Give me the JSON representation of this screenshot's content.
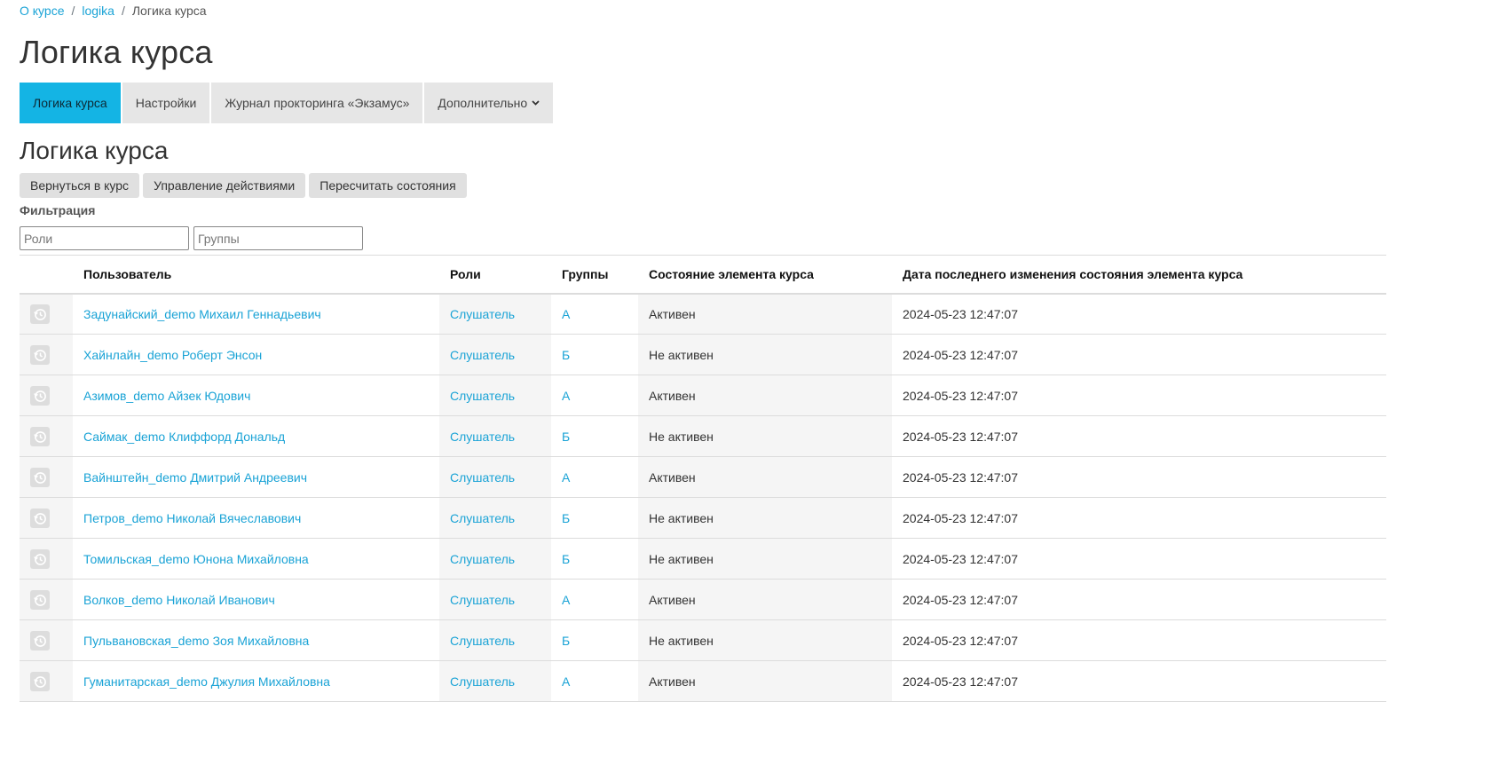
{
  "breadcrumb": {
    "items": [
      {
        "label": "О курсе",
        "link": true
      },
      {
        "label": "logika",
        "link": true
      },
      {
        "label": "Логика курса",
        "link": false
      }
    ],
    "separator": "/"
  },
  "page_title": "Логика курса",
  "tabs": [
    {
      "label": "Логика курса",
      "active": true
    },
    {
      "label": "Настройки",
      "active": false
    },
    {
      "label": "Журнал прокторинга «Экзамус»",
      "active": false
    },
    {
      "label": "Дополнительно",
      "active": false,
      "dropdown": true
    }
  ],
  "section_title": "Логика курса",
  "actions": {
    "back": "Вернуться в курс",
    "manage": "Управление действиями",
    "recalc": "Пересчитать состояния"
  },
  "filter": {
    "label": "Фильтрация",
    "roles_placeholder": "Роли",
    "groups_placeholder": "Группы"
  },
  "table": {
    "headers": {
      "user": "Пользователь",
      "roles": "Роли",
      "groups": "Группы",
      "state": "Состояние элемента курса",
      "date": "Дата последнего изменения состояния элемента курса"
    },
    "rows": [
      {
        "user": "Задунайский_demo Михаил Геннадьевич",
        "role": "Слушатель",
        "group": "А",
        "state": "Активен",
        "date": "2024-05-23 12:47:07"
      },
      {
        "user": "Хайнлайн_demo Роберт Энсон",
        "role": "Слушатель",
        "group": "Б",
        "state": "Не активен",
        "date": "2024-05-23 12:47:07"
      },
      {
        "user": "Азимов_demo Айзек Юдович",
        "role": "Слушатель",
        "group": "А",
        "state": "Активен",
        "date": "2024-05-23 12:47:07"
      },
      {
        "user": "Саймак_demo Клиффорд Дональд",
        "role": "Слушатель",
        "group": "Б",
        "state": "Не активен",
        "date": "2024-05-23 12:47:07"
      },
      {
        "user": "Вайнштейн_demo Дмитрий Андреевич",
        "role": "Слушатель",
        "group": "А",
        "state": "Активен",
        "date": "2024-05-23 12:47:07"
      },
      {
        "user": "Петров_demo Николай Вячеславович",
        "role": "Слушатель",
        "group": "Б",
        "state": "Не активен",
        "date": "2024-05-23 12:47:07"
      },
      {
        "user": "Томильская_demo Юнона Михайловна",
        "role": "Слушатель",
        "group": "Б",
        "state": "Не активен",
        "date": "2024-05-23 12:47:07"
      },
      {
        "user": "Волков_demo Николай Иванович",
        "role": "Слушатель",
        "group": "А",
        "state": "Активен",
        "date": "2024-05-23 12:47:07"
      },
      {
        "user": "Пульвановская_demo Зоя Михайловна",
        "role": "Слушатель",
        "group": "Б",
        "state": "Не активен",
        "date": "2024-05-23 12:47:07"
      },
      {
        "user": "Гуманитарская_demo Джулия Михайловна",
        "role": "Слушатель",
        "group": "А",
        "state": "Активен",
        "date": "2024-05-23 12:47:07"
      }
    ],
    "row_icon": "history-clock-icon"
  },
  "colors": {
    "accent": "#14b4e4",
    "link": "#1aa3d6",
    "tab_bg": "#e6e6e6",
    "shaded_cell": "#f5f5f5"
  }
}
